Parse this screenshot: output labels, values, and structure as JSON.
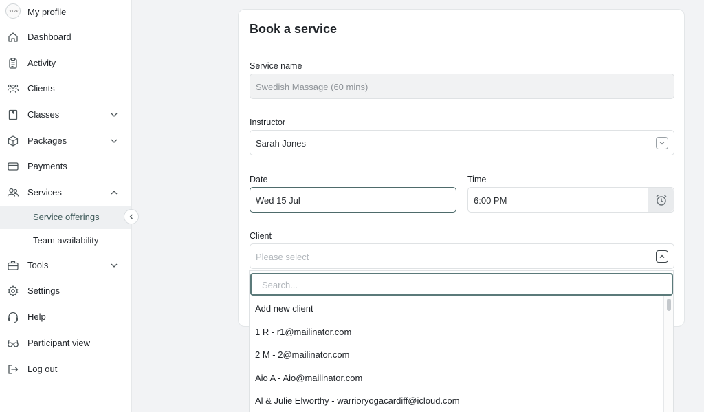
{
  "sidebar": {
    "profile": {
      "label": "My profile",
      "avatar_text": "CORE"
    },
    "items": [
      {
        "label": "Dashboard",
        "icon": "home-icon"
      },
      {
        "label": "Activity",
        "icon": "clipboard-icon"
      },
      {
        "label": "Clients",
        "icon": "users-group-icon"
      },
      {
        "label": "Classes",
        "icon": "book-icon",
        "expandable": true
      },
      {
        "label": "Packages",
        "icon": "box-icon",
        "expandable": true
      },
      {
        "label": "Payments",
        "icon": "card-icon"
      },
      {
        "label": "Services",
        "icon": "people-icon",
        "expanded": true
      },
      {
        "label": "Tools",
        "icon": "briefcase-icon",
        "expandable": true
      },
      {
        "label": "Settings",
        "icon": "gear-icon"
      },
      {
        "label": "Help",
        "icon": "headset-icon"
      },
      {
        "label": "Participant view",
        "icon": "glasses-icon"
      },
      {
        "label": "Log out",
        "icon": "logout-icon"
      }
    ],
    "sub_items": [
      {
        "label": "Service offerings",
        "active": true
      },
      {
        "label": "Team availability",
        "active": false
      }
    ]
  },
  "form": {
    "title": "Book a service",
    "service_name": {
      "label": "Service name",
      "value": "Swedish Massage (60 mins)"
    },
    "instructor": {
      "label": "Instructor",
      "value": "Sarah Jones"
    },
    "date": {
      "label": "Date",
      "value": "Wed 15 Jul"
    },
    "time": {
      "label": "Time",
      "value": "6:00 PM"
    },
    "client": {
      "label": "Client",
      "placeholder": "Please select"
    }
  },
  "dropdown": {
    "search_placeholder": "Search...",
    "options": [
      "Add new client",
      "1 R - r1@mailinator.com",
      "2 M - 2@mailinator.com",
      "Aio A - Aio@mailinator.com",
      "Al & Julie Elworthy - warrioryogacardiff@icloud.com"
    ]
  },
  "colors": {
    "accent": "#4e6b6b",
    "active_bg": "#eef0f2"
  }
}
